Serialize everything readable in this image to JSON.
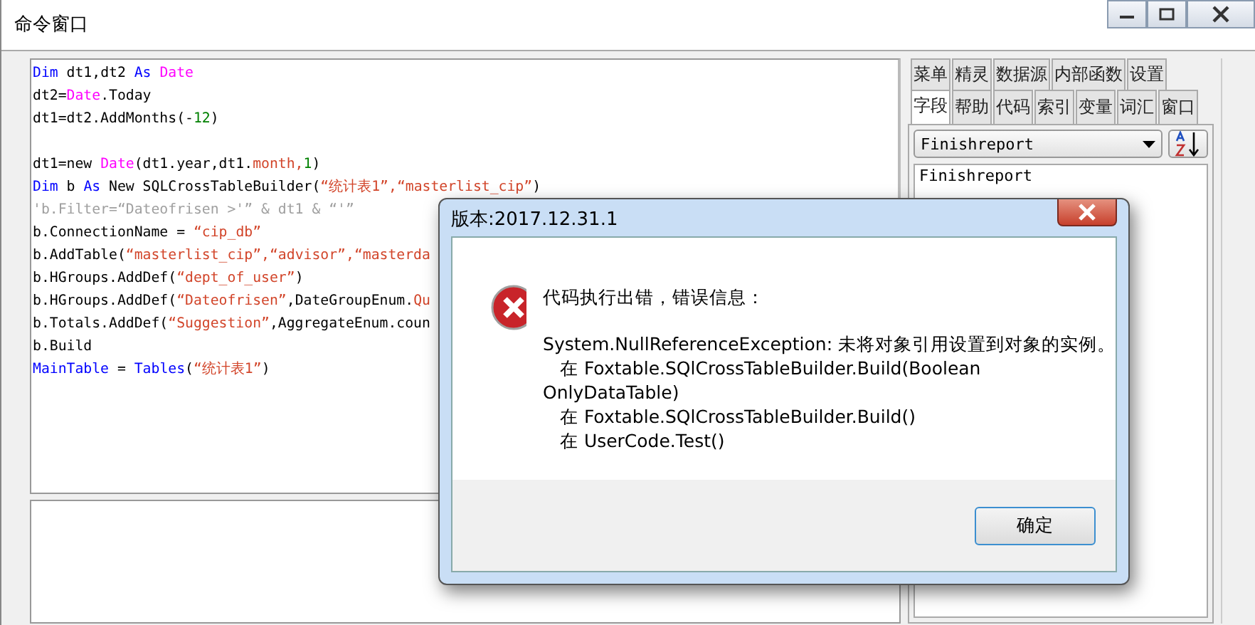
{
  "window": {
    "title": "命令窗口"
  },
  "editor": {
    "lines": [
      {
        "kind": "code",
        "tokens": [
          {
            "kind": "kw",
            "text": "Dim"
          },
          {
            "kind": "plain",
            "text": " dt1,dt2 "
          },
          {
            "kind": "kw",
            "text": "As "
          },
          {
            "kind": "type",
            "text": "Date"
          }
        ]
      },
      {
        "kind": "code",
        "tokens": [
          {
            "kind": "plain",
            "text": "dt2="
          },
          {
            "kind": "type",
            "text": "Date"
          },
          {
            "kind": "plain",
            "text": ".Today"
          }
        ]
      },
      {
        "kind": "code",
        "tokens": [
          {
            "kind": "plain",
            "text": "dt1=dt2.AddMonths(-"
          },
          {
            "kind": "num",
            "text": "12"
          },
          {
            "kind": "plain",
            "text": ")"
          }
        ]
      },
      {
        "kind": "blank"
      },
      {
        "kind": "code",
        "tokens": [
          {
            "kind": "plain",
            "text": "dt1=new "
          },
          {
            "kind": "type",
            "text": "Date"
          },
          {
            "kind": "plain",
            "text": "(dt1.year,dt1."
          },
          {
            "kind": "str",
            "text": "month,"
          },
          {
            "kind": "num",
            "text": "1"
          },
          {
            "kind": "plain",
            "text": ")"
          }
        ]
      },
      {
        "kind": "code",
        "tokens": [
          {
            "kind": "kw",
            "text": "Dim"
          },
          {
            "kind": "plain",
            "text": " b "
          },
          {
            "kind": "kw",
            "text": "As"
          },
          {
            "kind": "plain",
            "text": " New SQLCrossTableBuilder("
          },
          {
            "kind": "str",
            "text": "“统计表1”,"
          },
          {
            "kind": "str",
            "text": "“masterlist_cip”"
          },
          {
            "kind": "plain",
            "text": ")"
          }
        ]
      },
      {
        "kind": "code",
        "tokens": [
          {
            "kind": "comment",
            "text": "'b.Filter=“Dateofrisen >'” & dt1 & “'”"
          }
        ]
      },
      {
        "kind": "code",
        "tokens": [
          {
            "kind": "plain",
            "text": "b.ConnectionName = "
          },
          {
            "kind": "str",
            "text": "“cip_db”"
          }
        ]
      },
      {
        "kind": "code",
        "tokens": [
          {
            "kind": "plain",
            "text": "b.AddTable("
          },
          {
            "kind": "str",
            "text": "“masterlist_cip”,"
          },
          {
            "kind": "str",
            "text": "“advisor”,"
          },
          {
            "kind": "str",
            "text": "“masterda"
          }
        ]
      },
      {
        "kind": "code",
        "tokens": [
          {
            "kind": "plain",
            "text": "b.HGroups.AddDef("
          },
          {
            "kind": "str",
            "text": "“dept_of_user”"
          },
          {
            "kind": "plain",
            "text": ")"
          }
        ]
      },
      {
        "kind": "code",
        "tokens": [
          {
            "kind": "plain",
            "text": "b.HGroups.AddDef("
          },
          {
            "kind": "str",
            "text": "“Dateofrisen”"
          },
          {
            "kind": "plain",
            "text": ",DateGroupEnum."
          },
          {
            "kind": "str",
            "text": "Qu"
          }
        ]
      },
      {
        "kind": "code",
        "tokens": [
          {
            "kind": "plain",
            "text": "b.Totals.AddDef("
          },
          {
            "kind": "str",
            "text": "“Suggestion”"
          },
          {
            "kind": "plain",
            "text": ",AggregateEnum.coun"
          }
        ]
      },
      {
        "kind": "code",
        "tokens": [
          {
            "kind": "plain",
            "text": "b.Build"
          }
        ]
      },
      {
        "kind": "code",
        "tokens": [
          {
            "kind": "kw",
            "text": "MainTable"
          },
          {
            "kind": "plain",
            "text": " = "
          },
          {
            "kind": "kw",
            "text": "Tables"
          },
          {
            "kind": "plain",
            "text": "("
          },
          {
            "kind": "str",
            "text": "“统计表1”"
          },
          {
            "kind": "plain",
            "text": ")"
          }
        ]
      }
    ]
  },
  "side_panel": {
    "tab_rows": [
      [
        {
          "label": "菜单",
          "selected": false
        },
        {
          "label": "精灵",
          "selected": false
        },
        {
          "label": "数据源",
          "selected": false
        },
        {
          "label": "内部函数",
          "selected": false
        },
        {
          "label": "设置",
          "selected": false
        }
      ],
      [
        {
          "label": "字段",
          "selected": true
        },
        {
          "label": "帮助",
          "selected": false
        },
        {
          "label": "代码",
          "selected": false
        },
        {
          "label": "索引",
          "selected": false
        },
        {
          "label": "变量",
          "selected": false
        },
        {
          "label": "词汇",
          "selected": false
        },
        {
          "label": "窗口",
          "selected": false
        }
      ]
    ],
    "table_select": {
      "value": "Finishreport"
    },
    "field_list": [
      "Finishreport"
    ]
  },
  "dialog": {
    "title": "版本:2017.12.31.1",
    "heading": "代码执行出错，错误信息：",
    "message_lines": [
      "System.NullReferenceException: 未将对象引用设置到对象的实例。",
      "   在 Foxtable.SQlCrossTableBuilder.Build(Boolean",
      "OnlyDataTable)",
      "   在 Foxtable.SQlCrossTableBuilder.Build()",
      "   在 UserCode.Test()"
    ],
    "button": "确定"
  }
}
